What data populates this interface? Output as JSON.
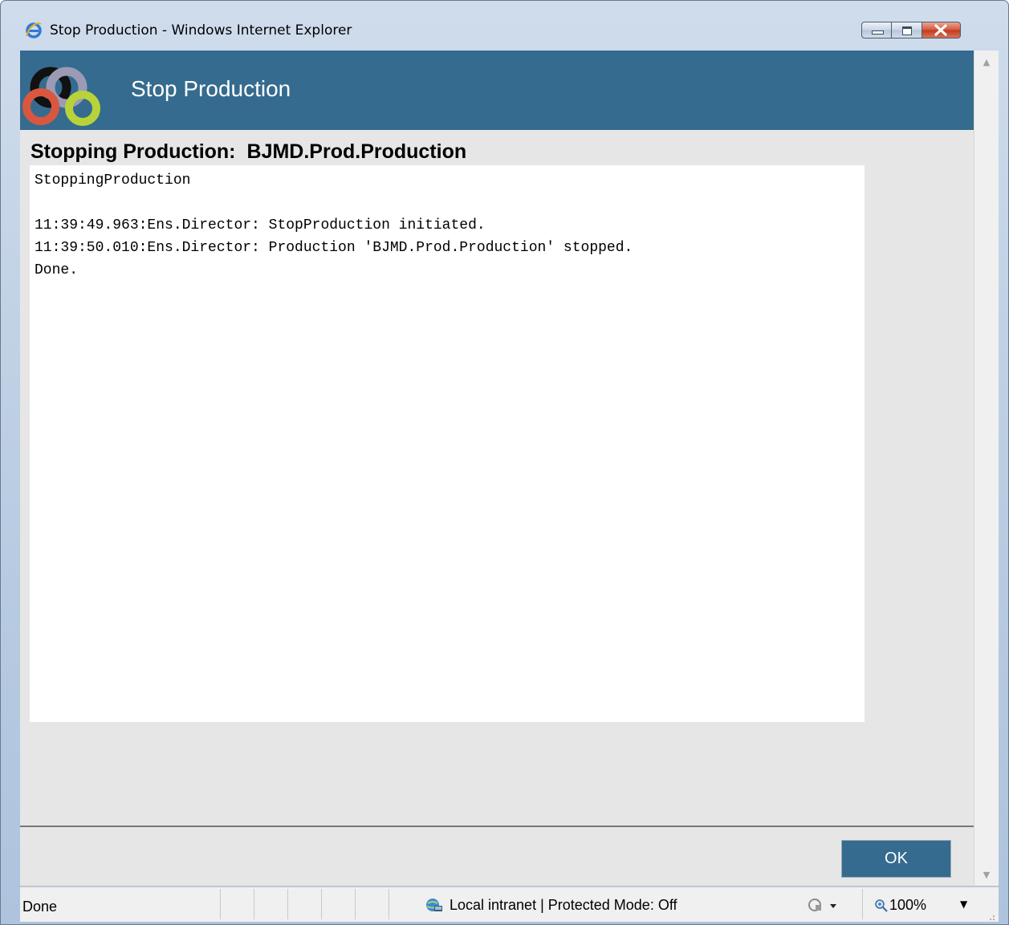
{
  "window": {
    "title": "Stop Production - Windows Internet Explorer"
  },
  "banner": {
    "title": "Stop Production"
  },
  "heading": {
    "label": "Stopping Production:",
    "production_name": "BJMD.Prod.Production"
  },
  "output": {
    "lines": [
      "StoppingProduction",
      "",
      "11:39:49.963:Ens.Director: StopProduction initiated.",
      "11:39:50.010:Ens.Director: Production 'BJMD.Prod.Production' stopped.",
      "Done."
    ]
  },
  "buttons": {
    "ok_label": "OK"
  },
  "statusbar": {
    "status": "Done",
    "zone": "Local intranet | Protected Mode: Off",
    "zoom": "100%"
  },
  "icons": {
    "app": "internet-explorer-icon",
    "logo": "interlinked-rings-logo",
    "minimize": "minimize-icon",
    "maximize": "maximize-icon",
    "close": "close-icon",
    "zone": "local-intranet-icon",
    "protected_mode": "protected-mode-icon",
    "zoom": "magnifier-icon"
  },
  "colors": {
    "banner": "#356b8e",
    "ok_button": "#356b8e",
    "client_background": "#e6e6e6",
    "logo_black": "#111111",
    "logo_gray": "#9b9bb5",
    "logo_red": "#d9573f",
    "logo_green": "#b8d33a"
  }
}
